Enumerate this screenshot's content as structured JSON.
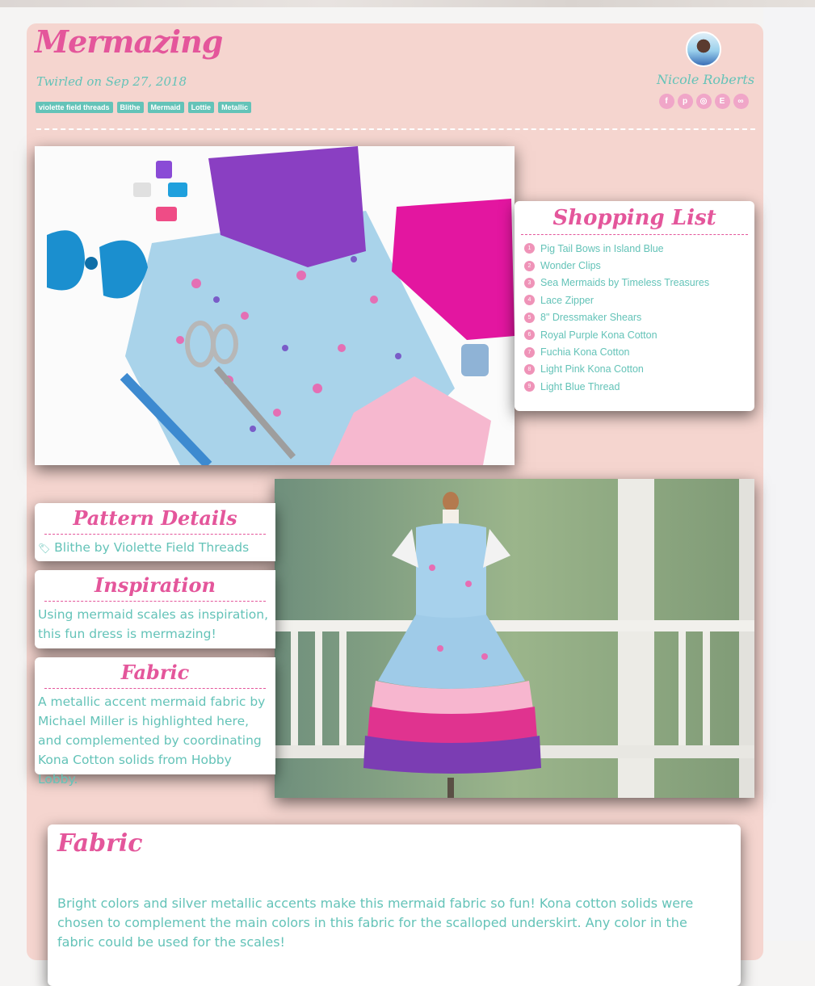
{
  "post": {
    "title": "Mermazing",
    "twirled": "Twirled on Sep 27, 2018",
    "tags": [
      "violette field threads",
      "Blithe",
      "Mermaid",
      "Lottie",
      "Metallic"
    ]
  },
  "author": {
    "name": "Nicole Roberts",
    "socials": [
      {
        "icon": "facebook-icon",
        "glyph": "f"
      },
      {
        "icon": "pinterest-icon",
        "glyph": "p"
      },
      {
        "icon": "instagram-icon",
        "glyph": "◎"
      },
      {
        "icon": "etsy-icon",
        "glyph": "E"
      },
      {
        "icon": "link-icon",
        "glyph": "∞"
      }
    ]
  },
  "shopping_list": {
    "title": "Shopping List",
    "items": [
      {
        "num": "1",
        "label": "Pig Tail Bows in Island Blue"
      },
      {
        "num": "2",
        "label": "Wonder Clips"
      },
      {
        "num": "3",
        "label": "Sea Mermaids by Timeless Treasures"
      },
      {
        "num": "4",
        "label": "Lace Zipper"
      },
      {
        "num": "5",
        "label": "8\" Dressmaker Shears"
      },
      {
        "num": "6",
        "label": "Royal Purple Kona Cotton"
      },
      {
        "num": "7",
        "label": "Fuchia Kona Cotton"
      },
      {
        "num": "8",
        "label": "Light Pink Kona Cotton"
      },
      {
        "num": "9",
        "label": "Light Blue Thread"
      }
    ]
  },
  "pattern_details": {
    "title": "Pattern Details",
    "link": "Blithe by Violette Field Threads"
  },
  "inspiration": {
    "title": "Inspiration",
    "text": "Using mermaid scales as inspiration, this fun dress is mermazing!"
  },
  "fabric_side": {
    "title": "Fabric",
    "text": "A metallic accent mermaid fabric by Michael Miller is highlighted here, and complemented by coordinating Kona Cotton solids from Hobby Lobby."
  },
  "fabric_section": {
    "title": "Fabric",
    "text": "Bright colors and silver metallic accents make this mermaid fabric so fun! Kona cotton solids were chosen to complement the main colors in this fabric for the scalloped underskirt. Any color in the fabric could be used for the scales!"
  },
  "colors": {
    "accent_pink": "#e4569b",
    "accent_teal": "#64c3b8",
    "card_background": "#f5d5cf"
  }
}
